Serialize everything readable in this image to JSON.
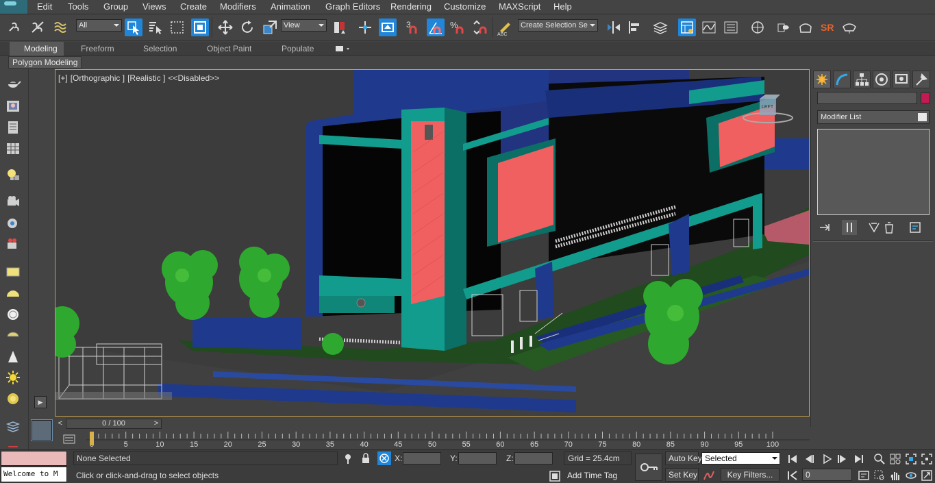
{
  "menu": {
    "items": [
      "Edit",
      "Tools",
      "Group",
      "Views",
      "Create",
      "Modifiers",
      "Animation",
      "Graph Editors",
      "Rendering",
      "Customize",
      "MAXScript",
      "Help"
    ]
  },
  "toolbar": {
    "selection_filter": "All",
    "reference_coord": "View",
    "named_selection_placeholder": "Create Selection Se",
    "snap_number": "3",
    "angle_label": "%",
    "sr_label": "SR"
  },
  "ribbon": {
    "tabs": [
      "Modeling",
      "Freeform",
      "Selection",
      "Object Paint",
      "Populate"
    ],
    "active_tab": "Modeling",
    "sub_panel": "Polygon Modeling"
  },
  "viewport": {
    "plus": "[+]",
    "view": "[Orthographic ]",
    "shading": "[Realistic ]",
    "disabled": "<<Disabled>>",
    "viewcube_label": "LEFT"
  },
  "command_panel": {
    "modifier_list": "Modifier List",
    "object_color": "#c31a52"
  },
  "timeline": {
    "slider_text": "0 / 100",
    "prev_arrow": "<",
    "next_arrow": ">",
    "ticks": [
      "0",
      "5",
      "10",
      "15",
      "20",
      "25",
      "30",
      "35",
      "40",
      "45",
      "50",
      "55",
      "60",
      "65",
      "70",
      "75",
      "80",
      "85",
      "90",
      "95",
      "100"
    ]
  },
  "status": {
    "maxscript_output": "Welcome to M",
    "selection_status": "None Selected",
    "prompt": "Click or click-and-drag to select objects",
    "x_label": "X:",
    "y_label": "Y:",
    "z_label": "Z:",
    "grid": "Grid = 25.4cm",
    "add_time_tag": "Add Time Tag",
    "auto_key": "Auto Key",
    "set_key": "Set Key",
    "key_mode": "Selected",
    "key_filters": "Key Filters...",
    "current_frame": "0"
  },
  "colors": {
    "accent_blue": "#1f86d9",
    "viewport_border": "#c8a24a",
    "building_navy": "#1f3a8c",
    "building_teal": "#129c8e",
    "billboard_red": "#f06060",
    "tree_green": "#2fa82f"
  }
}
